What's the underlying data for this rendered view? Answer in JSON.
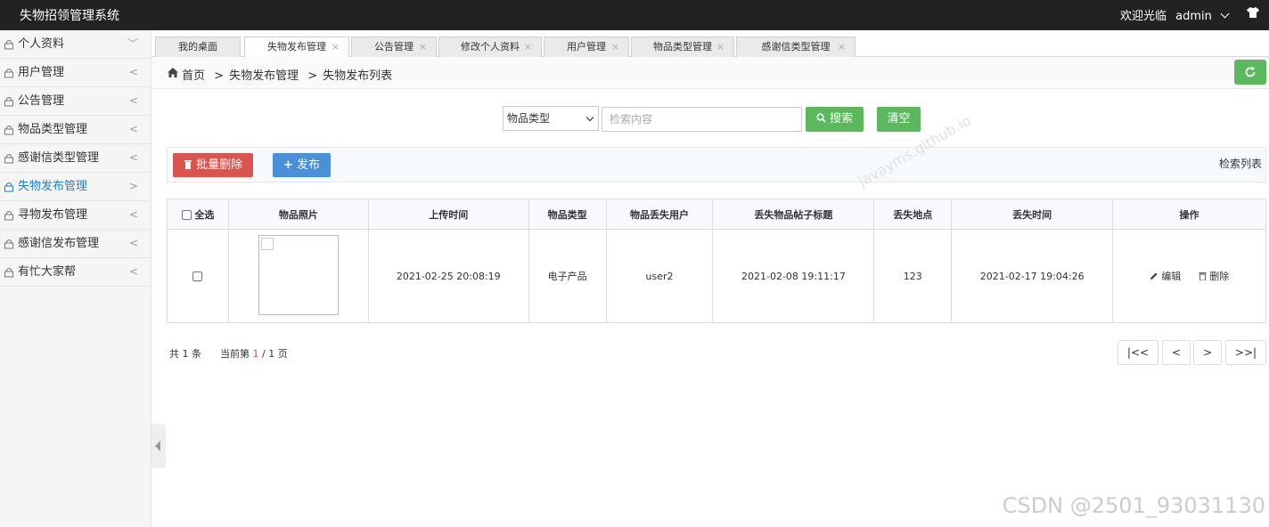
{
  "header": {
    "title": "失物招领管理系统",
    "welcome": "欢迎光临",
    "user": "admin"
  },
  "sidebar": {
    "items": [
      {
        "label": "个人资料",
        "arrow": "﹀"
      },
      {
        "label": "用户管理",
        "arrow": "<"
      },
      {
        "label": "公告管理",
        "arrow": "<"
      },
      {
        "label": "物品类型管理",
        "arrow": "<"
      },
      {
        "label": "感谢信类型管理",
        "arrow": "<"
      },
      {
        "label": "失物发布管理",
        "arrow": ">"
      },
      {
        "label": "寻物发布管理",
        "arrow": "<"
      },
      {
        "label": "感谢信发布管理",
        "arrow": "<"
      },
      {
        "label": "有忙大家帮",
        "arrow": "<"
      }
    ]
  },
  "tabs": [
    {
      "label": "我的桌面"
    },
    {
      "label": "失物发布管理"
    },
    {
      "label": "公告管理"
    },
    {
      "label": "修改个人资料"
    },
    {
      "label": "用户管理"
    },
    {
      "label": "物品类型管理"
    },
    {
      "label": "感谢信类型管理"
    }
  ],
  "breadcrumb": {
    "home": "首页",
    "level1": "失物发布管理",
    "level2": "失物发布列表",
    "sep": ">"
  },
  "search": {
    "select": "物品类型",
    "placeholder": "检索内容",
    "search_label": "搜索",
    "clear_label": "清空"
  },
  "toolbar": {
    "batch_delete": "批量删除",
    "publish": "发布",
    "right_label": "检索列表"
  },
  "table": {
    "headers": [
      "全选",
      "物品照片",
      "上传时间",
      "物品类型",
      "物品丢失用户",
      "丢失物品帖子标题",
      "丢失地点",
      "丢失时间",
      "操作"
    ],
    "rows": [
      {
        "upload_time": "2021-02-25 20:08:19",
        "type": "电子产品",
        "user": "user2",
        "title": "2021-02-08 19:11:17",
        "place": "123",
        "lost_time": "2021-02-17 19:04:26",
        "edit": "编辑",
        "delete": "删除"
      }
    ]
  },
  "pagination": {
    "total_prefix": "共",
    "total": "1",
    "total_suffix": "条",
    "current_prefix": "当前第",
    "current": "1",
    "slash": "/",
    "pages": "1",
    "pages_suffix": "页",
    "first": "|<<",
    "prev": "<",
    "next": ">",
    "last": ">>|"
  },
  "watermark": {
    "corner": "CSDN @2501_93031130",
    "diagonal": "javayms.github.io"
  },
  "colors": {
    "green": "#5cb85c",
    "red": "#d9534f",
    "blue": "#4a90d9",
    "active": "#1e7fc8"
  }
}
